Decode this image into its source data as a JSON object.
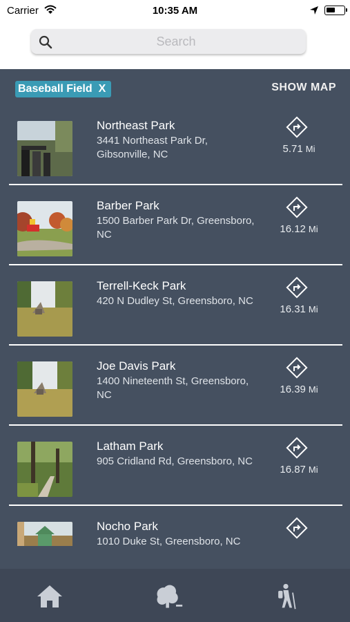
{
  "status": {
    "carrier": "Carrier",
    "time": "10:35 AM"
  },
  "search": {
    "placeholder": "Search"
  },
  "filter": {
    "label": "Baseball Field",
    "remove": "X"
  },
  "show_map": "SHOW MAP",
  "parks": [
    {
      "name": "Northeast Park",
      "address": "3441 Northeast Park Dr, Gibsonville, NC",
      "distance": "5.71",
      "unit": "Mi"
    },
    {
      "name": "Barber Park",
      "address": "1500 Barber Park Dr, Greensboro, NC",
      "distance": "16.12",
      "unit": "Mi"
    },
    {
      "name": "Terrell-Keck Park",
      "address": "420 N Dudley St, Greensboro, NC",
      "distance": "16.31",
      "unit": "Mi"
    },
    {
      "name": "Joe Davis Park",
      "address": "1400 Nineteenth St, Greensboro, NC",
      "distance": "16.39",
      "unit": "Mi"
    },
    {
      "name": "Latham Park",
      "address": "905 Cridland Rd, Greensboro, NC",
      "distance": "16.87",
      "unit": "Mi"
    },
    {
      "name": "Nocho Park",
      "address": "1010 Duke St, Greensboro, NC",
      "distance": "",
      "unit": ""
    }
  ],
  "colors": {
    "background": "#455060",
    "chip": "#3a9bb5",
    "tab_bar": "#3e4756"
  },
  "icons": {
    "tabs": [
      "home-icon",
      "tree-icon",
      "hiker-icon"
    ]
  }
}
